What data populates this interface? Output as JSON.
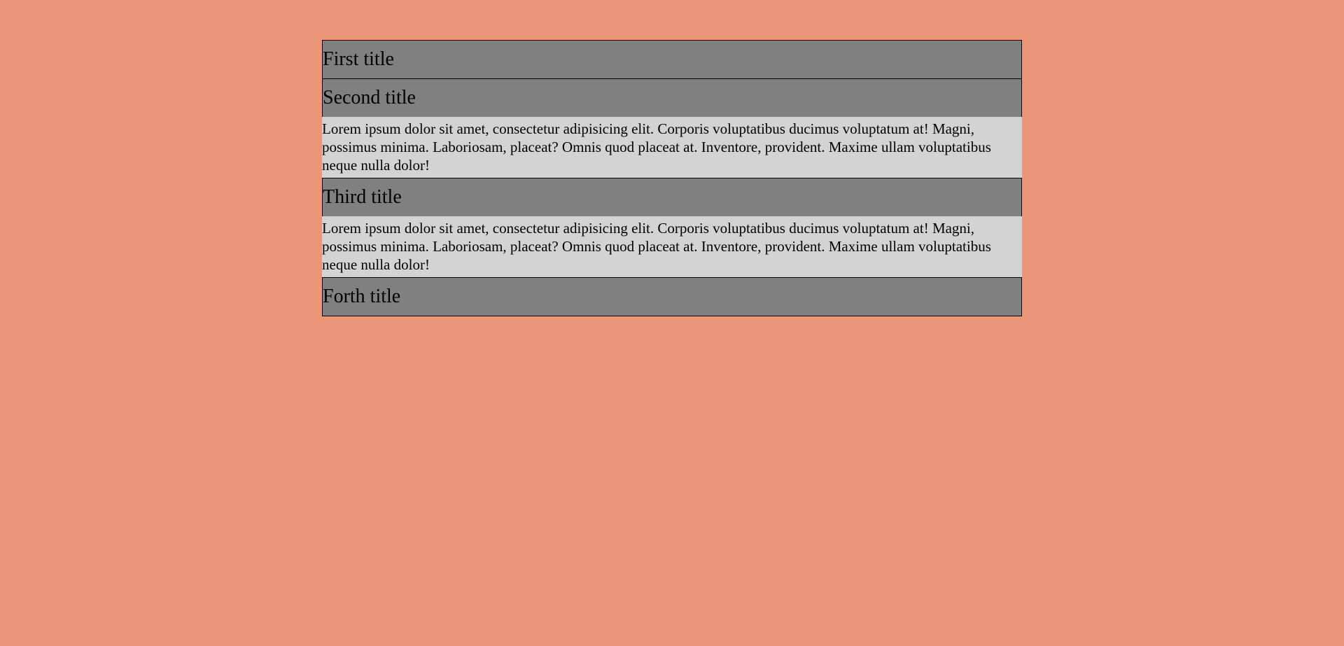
{
  "accordion": {
    "items": [
      {
        "title": "First title",
        "expanded": false,
        "content": ""
      },
      {
        "title": "Second title",
        "expanded": true,
        "content": "Lorem ipsum dolor sit amet, consectetur adipisicing elit. Corporis voluptatibus ducimus voluptatum at! Magni, possimus minima. Laboriosam, placeat? Omnis quod placeat at. Inventore, provident. Maxime ullam voluptatibus neque nulla dolor!"
      },
      {
        "title": "Third title",
        "expanded": true,
        "content": "Lorem ipsum dolor sit amet, consectetur adipisicing elit. Corporis voluptatibus ducimus voluptatum at! Magni, possimus minima. Laboriosam, placeat? Omnis quod placeat at. Inventore, provident. Maxime ullam voluptatibus neque nulla dolor!"
      },
      {
        "title": "Forth title",
        "expanded": false,
        "content": ""
      }
    ]
  },
  "colors": {
    "background": "#EB9579",
    "title_bg": "#808080",
    "content_bg": "#D3D3D3",
    "border": "#000000"
  }
}
